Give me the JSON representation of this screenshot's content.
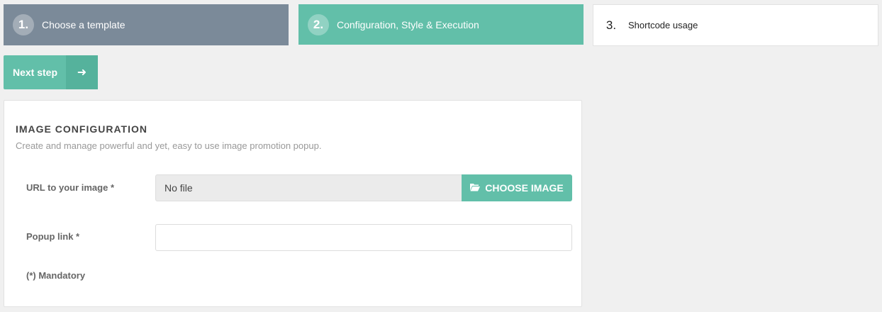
{
  "steps": [
    {
      "number": "1.",
      "label": "Choose a template",
      "state": "done"
    },
    {
      "number": "2.",
      "label": "Configuration, Style & Execution",
      "state": "active"
    },
    {
      "number": "3.",
      "label": "Shortcode usage",
      "state": "pending"
    }
  ],
  "next_button": {
    "label": "Next step",
    "icon": "arrow-right-icon"
  },
  "panel": {
    "title": "IMAGE CONFIGURATION",
    "description": "Create and manage powerful and yet, easy to use image promotion popup.",
    "url_field": {
      "label": "URL to your image *",
      "value": "No file",
      "button_label": "CHOOSE IMAGE",
      "button_icon": "folder-open-icon"
    },
    "popup_field": {
      "label": "Popup link *",
      "value": "",
      "placeholder": ""
    },
    "mandatory_note": "(*) Mandatory"
  },
  "colors": {
    "accent": "#62bfa9",
    "done_step": "#7b8a99",
    "background": "#f0f0f0"
  }
}
